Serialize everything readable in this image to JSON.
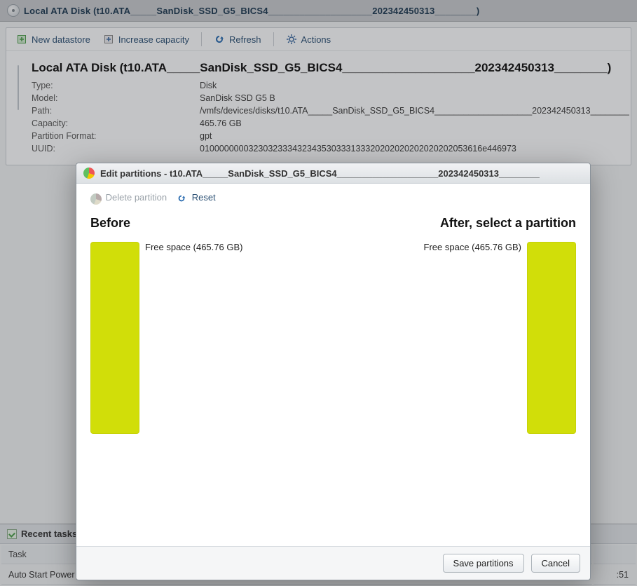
{
  "page": {
    "title": "Local ATA Disk (t10.ATA_____SanDisk_SSD_G5_BICS4____________________202342450313________)"
  },
  "toolbar": {
    "new_datastore": "New datastore",
    "increase_capacity": "Increase capacity",
    "refresh": "Refresh",
    "actions": "Actions"
  },
  "props": {
    "heading": "Local ATA Disk (t10.ATA_____SanDisk_SSD_G5_BICS4____________________202342450313________)",
    "rows": {
      "type": {
        "label": "Type:",
        "value": "Disk"
      },
      "model": {
        "label": "Model:",
        "value": "SanDisk SSD G5 B"
      },
      "path": {
        "label": "Path:",
        "value": "/vmfs/devices/disks/t10.ATA_____SanDisk_SSD_G5_BICS4____________________202342450313________"
      },
      "capacity": {
        "label": "Capacity:",
        "value": "465.76 GB"
      },
      "format": {
        "label": "Partition Format:",
        "value": "gpt"
      },
      "uuid": {
        "label": "UUID:",
        "value": "0100000000323032333432343530333133320202020202020202053616e446973"
      }
    }
  },
  "tasks": {
    "header": "Recent tasks",
    "col_task": "Task",
    "col_time": "",
    "row0_task": "Auto Start Power On",
    "row0_time": ":51"
  },
  "dialog": {
    "title": "Edit partitions - t10.ATA_____SanDisk_SSD_G5_BICS4____________________202342450313________",
    "delete": "Delete partition",
    "reset": "Reset",
    "before": "Before",
    "after": "After, select a partition",
    "before_label": "Free space   (465.76 GB)",
    "after_label": "Free space   (465.76 GB)",
    "save": "Save partitions",
    "cancel": "Cancel"
  }
}
